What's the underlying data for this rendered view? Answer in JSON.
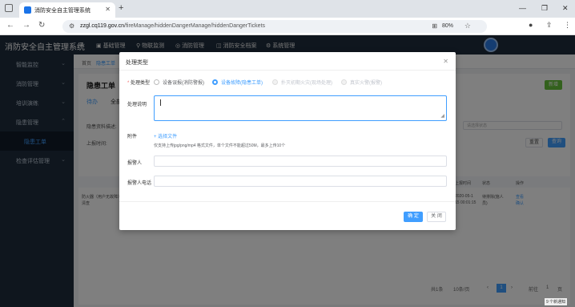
{
  "browser": {
    "tab_title": "消防安全自主管理系统",
    "url_domain": "zzgl.cq119.gov.cn",
    "url_path": "/fireManage/hiddenDangerManage/hiddenDangerTickets",
    "zoom": "80%"
  },
  "app": {
    "brand": "消防安全自主管理系统",
    "nav": [
      "基础管理",
      "物联监测",
      "消防管理",
      "消防安全档案",
      "系统管理"
    ]
  },
  "sidebar": {
    "items": [
      {
        "label": "智能监控"
      },
      {
        "label": "消防管理"
      },
      {
        "label": "培训演练"
      },
      {
        "label": "隐患管理"
      },
      {
        "label": "隐患工单"
      },
      {
        "label": "检查评估管理"
      }
    ]
  },
  "page": {
    "crumb_home": "首页",
    "crumb_current": "隐患工单",
    "title": "隐患工单",
    "add_btn": "新增",
    "tab_left": "待办",
    "tab_second": "全部",
    "filter_desc_label": "隐患资料描述:",
    "filter_time_label": "上报时间:",
    "filter_placeholder": "请选择状态",
    "reset_btn": "重置",
    "search_btn": "查询",
    "col_time": "上报时间",
    "col_status": "状态",
    "col_action": "操作",
    "row_desc": "防火器（用户无故障）等、需要",
    "row_desc2": "清查",
    "row_time": "2020-05-1",
    "row_time2": "15 00:01:15",
    "row_status": "待排除(施人",
    "row_status2": "员)",
    "row_act1": "查看",
    "row_act2": "确认",
    "pager_total": "共1条",
    "pager_size": "10条/页",
    "pager_page": "1",
    "pager_goto": "前往",
    "pager_goto_page": "1",
    "pager_unit": "页",
    "corner_badge": "9 个新通知"
  },
  "modal": {
    "title": "处理类型",
    "type_label": "处理类型",
    "radios": [
      "设备误报(消防警报)",
      "设备故障(隐患工单)",
      "扑灭初期火灾(现场处理)",
      "真实火警(报警)"
    ],
    "opinion_label": "处理说明",
    "attach_label": "附件",
    "upload_text": "+ 选择文件",
    "hint": "仅支持上传jpg/png/mp4 格式文件，单个文件不能超过50M，最多上传10个",
    "reporter_label": "报警人",
    "phone_label": "报警人电话",
    "confirm": "确 定",
    "cancel": "关 闭"
  }
}
